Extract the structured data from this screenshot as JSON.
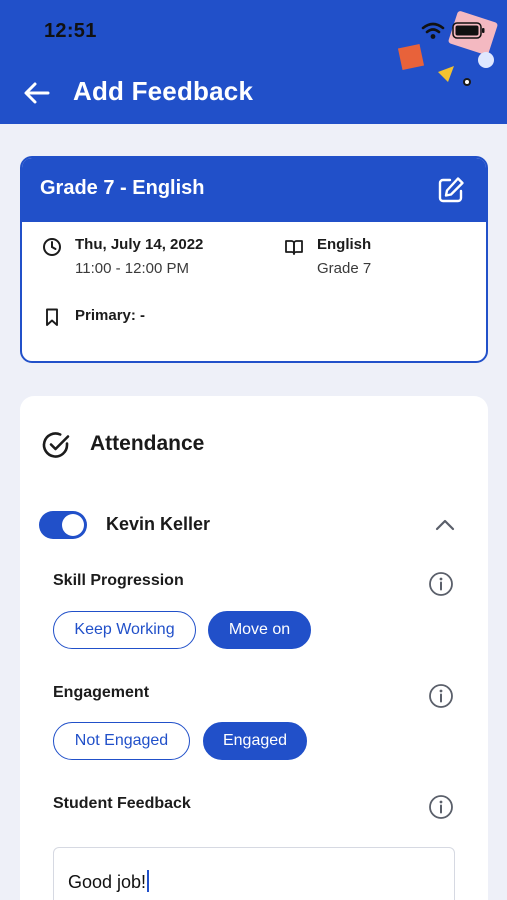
{
  "status_bar": {
    "time": "12:51"
  },
  "header": {
    "title": "Add Feedback"
  },
  "lesson": {
    "title": "Grade 7 - English",
    "date": "Thu, July 14, 2022",
    "time_range": "11:00 - 12:00 PM",
    "subject": "English",
    "grade": "Grade 7",
    "primary": "Primary: -"
  },
  "attendance": {
    "title": "Attendance",
    "student": {
      "name": "Kevin Keller",
      "present": true
    },
    "skill_progression": {
      "label": "Skill Progression",
      "options": [
        "Keep Working",
        "Move on"
      ],
      "selected": "Move on"
    },
    "engagement": {
      "label": "Engagement",
      "options": [
        "Not Engaged",
        "Engaged"
      ],
      "selected": "Engaged"
    },
    "student_feedback": {
      "label": "Student Feedback",
      "value": "Good job!"
    }
  },
  "colors": {
    "primary": "#2150c9",
    "background": "#eef0f8",
    "card": "#ffffff"
  }
}
